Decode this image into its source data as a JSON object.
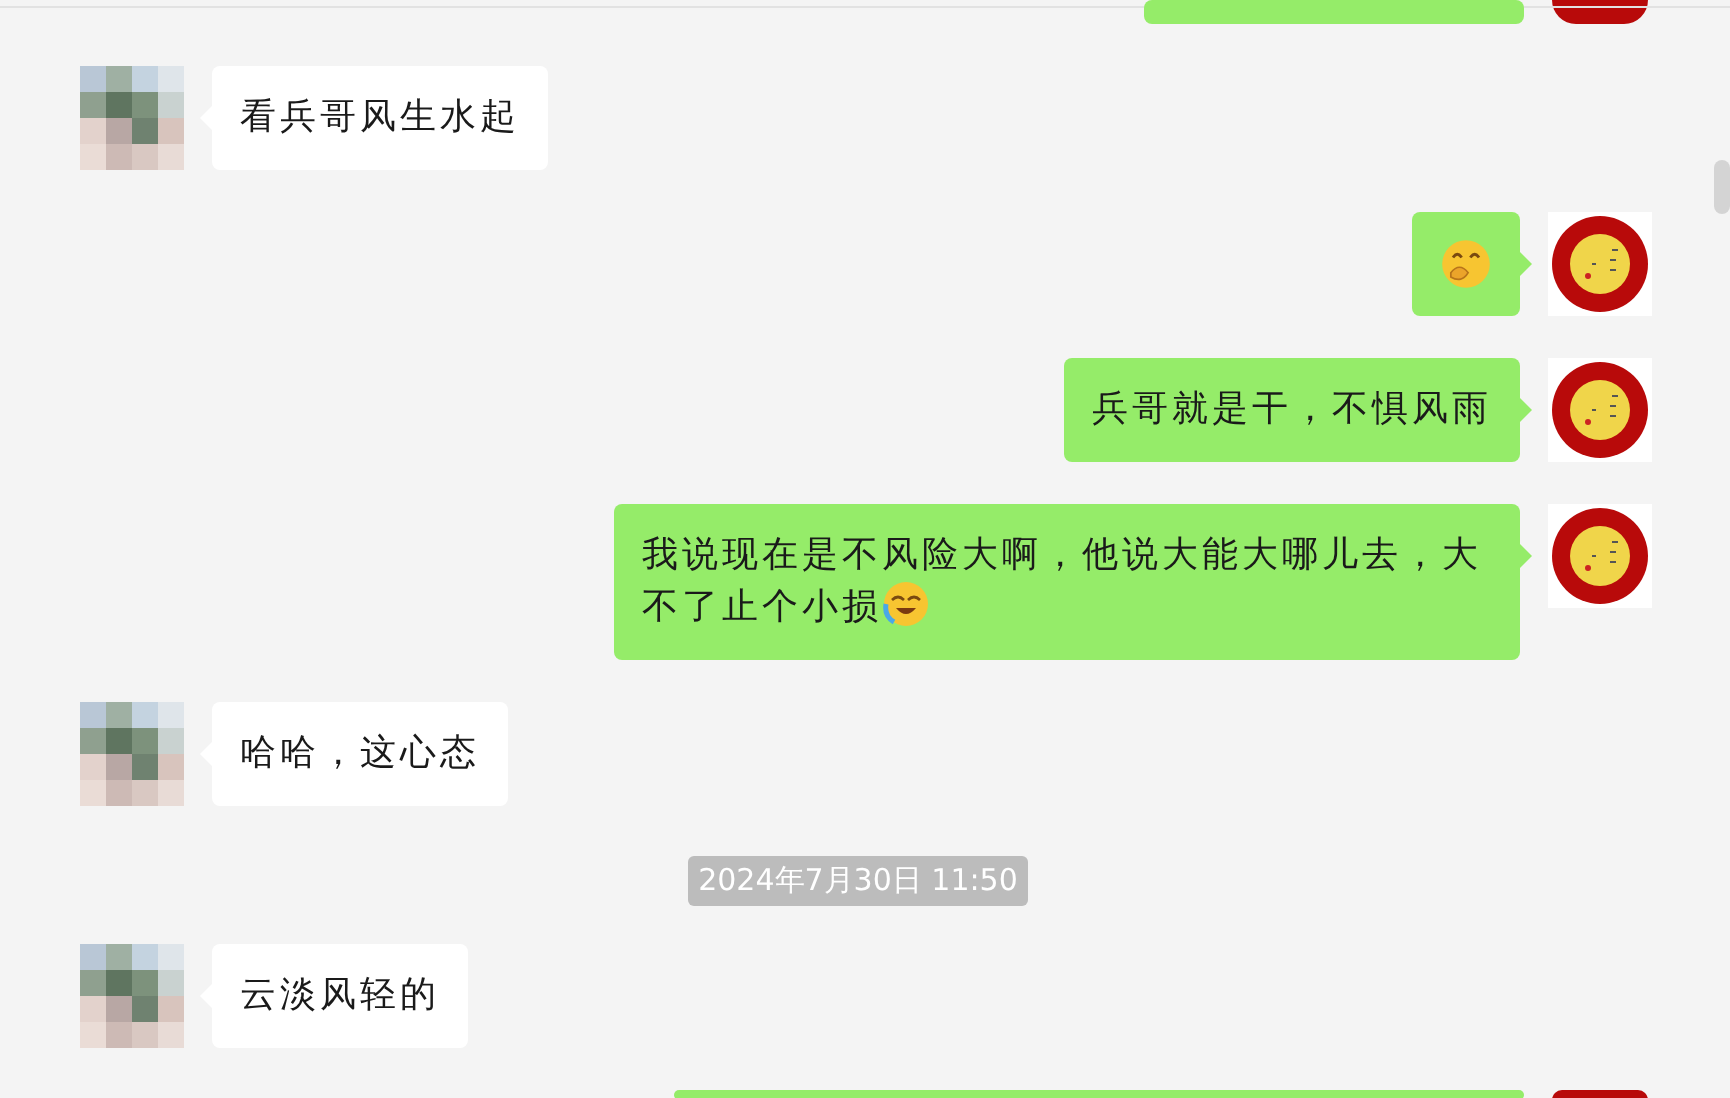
{
  "messages": [
    {
      "kind": "cut_off",
      "sent": true
    },
    {
      "kind": "text",
      "sent": false,
      "text": "看兵哥风生水起"
    },
    {
      "kind": "emoji",
      "sent": true
    },
    {
      "kind": "text",
      "sent": true,
      "text": "兵哥就是干，不惧风雨"
    },
    {
      "kind": "text",
      "sent": true,
      "text": "我说现在是不风险大啊，他说大能大哪儿去，大不了止个小损",
      "trailing_emoji": true
    },
    {
      "kind": "text",
      "sent": false,
      "text": "哈哈，这心态"
    },
    {
      "kind": "time",
      "text": "2024年7月30日 11:50"
    },
    {
      "kind": "text",
      "sent": false,
      "text": "云淡风轻的"
    },
    {
      "kind": "cut_off",
      "sent": true
    }
  ]
}
